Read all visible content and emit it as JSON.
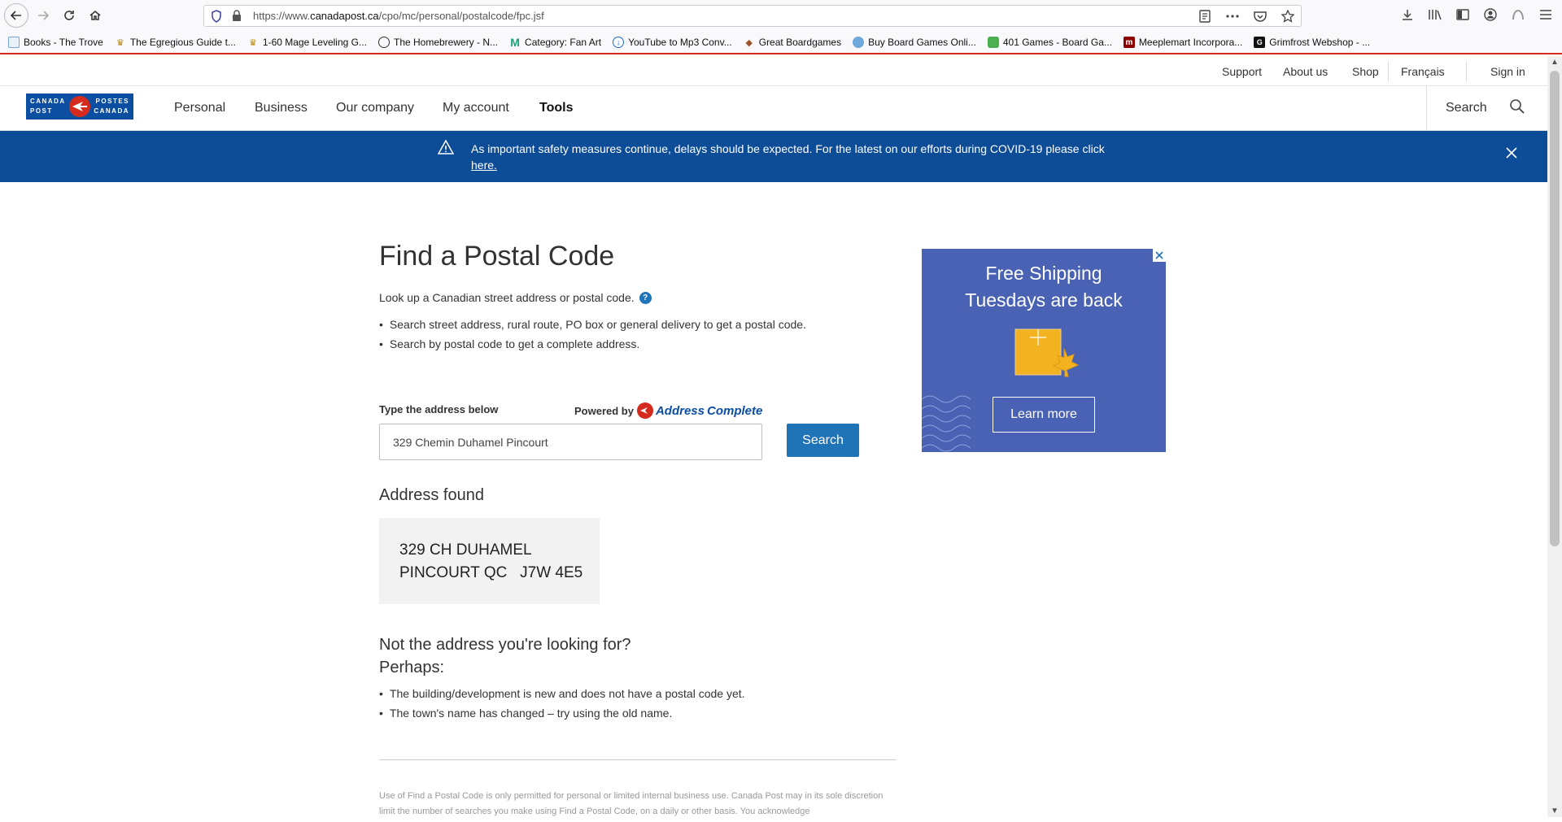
{
  "browser": {
    "url_prefix": "https://www.",
    "url_domain": "canadapost.ca",
    "url_path": "/cpo/mc/personal/postalcode/fpc.jsf",
    "bookmarks": [
      {
        "label": "Books - The Trove",
        "icon": "page-icon"
      },
      {
        "label": "The Egregious Guide t...",
        "icon": "crown-icon"
      },
      {
        "label": "1-60 Mage Leveling G...",
        "icon": "crown-icon"
      },
      {
        "label": "The Homebrewery - N...",
        "icon": "globe-icon"
      },
      {
        "label": "Category: Fan Art",
        "icon": "m-logo-icon"
      },
      {
        "label": "YouTube to Mp3 Conv...",
        "icon": "download-icon"
      },
      {
        "label": "Great Boardgames",
        "icon": "gem-icon"
      },
      {
        "label": "Buy Board Games Onli...",
        "icon": "shop-icon"
      },
      {
        "label": "401 Games - Board Ga...",
        "icon": "dice-icon"
      },
      {
        "label": "Meeplemart Incorpora...",
        "icon": "m-box-icon"
      },
      {
        "label": "Grimfrost Webshop - ...",
        "icon": "gf-icon"
      }
    ]
  },
  "utility_nav": {
    "support": "Support",
    "about": "About us",
    "shop": "Shop",
    "language": "Français",
    "signin": "Sign in"
  },
  "logo": {
    "left_top": "CANADA",
    "left_bottom": "POST",
    "right_top": "POSTES",
    "right_bottom": "CANADA"
  },
  "main_nav": {
    "items": [
      "Personal",
      "Business",
      "Our company",
      "My account",
      "Tools"
    ],
    "search_label": "Search"
  },
  "alert": {
    "text": "As important safety measures continue, delays should be expected. For the latest on our efforts during COVID-19 please click",
    "link": "here."
  },
  "main": {
    "title": "Find a Postal Code",
    "intro": "Look up a Canadian street address or postal code.",
    "bullets": [
      "Search street address, rural route, PO box or general delivery to get a postal code.",
      "Search by postal code to get a complete address."
    ],
    "input_label": "Type the address below",
    "powered_by": "Powered by",
    "ac_address": "Address",
    "ac_complete": "Complete",
    "input_value": "329 Chemin Duhamel Pincourt",
    "search_button": "Search",
    "found_title": "Address found",
    "found_line1": "329 CH DUHAMEL",
    "found_line2": "PINCOURT QC   J7W 4E5",
    "not_found_title": "Not the address you're looking for?",
    "not_found_sub": "Perhaps:",
    "not_found_bullets": [
      "The building/development is new and does not have a postal code yet.",
      "The town's name has changed – try using the old name."
    ],
    "legal": "Use of Find a Postal Code is only permitted for personal or limited internal business use. Canada Post may in its sole discretion limit the number of searches you make using Find a Postal Code, on a daily or other basis. You acknowledge"
  },
  "ad": {
    "title_line1": "Free Shipping",
    "title_line2": "Tuesdays are back",
    "button": "Learn more"
  },
  "colors": {
    "alert_bg": "#0d4d97",
    "primary_button": "#1f73b7",
    "brand_red": "#d52b1e",
    "ad_bg": "#4a62b3"
  }
}
